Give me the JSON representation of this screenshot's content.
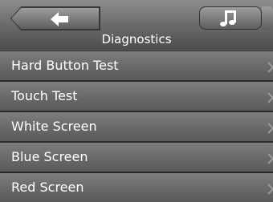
{
  "header": {
    "title": "Diagnostics",
    "back_icon": "arrow-left-icon",
    "music_icon": "music-note-icon"
  },
  "menu": {
    "items": [
      {
        "label": "Hard Button Test"
      },
      {
        "label": "Touch Test"
      },
      {
        "label": "White Screen"
      },
      {
        "label": "Blue Screen"
      },
      {
        "label": "Red Screen"
      }
    ]
  }
}
